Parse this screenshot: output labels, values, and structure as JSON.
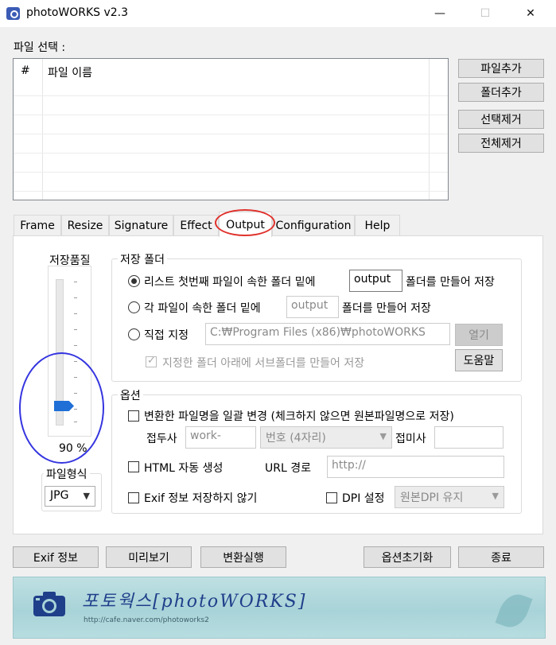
{
  "window": {
    "title": "photoWORKS v2.3",
    "minimize": "—",
    "maximize": "☐",
    "close": "✕"
  },
  "file_select": {
    "label": "파일 선택 :",
    "columns": [
      "#",
      "파일 이름"
    ],
    "buttons": {
      "add_file": "파일추가",
      "add_folder": "폴더추가",
      "remove_selected": "선택제거",
      "remove_all": "전체제거"
    }
  },
  "tabs": [
    "Frame",
    "Resize",
    "Signature",
    "Effect",
    "Output",
    "Configuration",
    "Help"
  ],
  "active_tab": "Output",
  "quality": {
    "label": "저장품질",
    "value": 90,
    "value_text": "90 %"
  },
  "file_format": {
    "label": "파일형식",
    "selected": "JPG"
  },
  "save_folder": {
    "label": "저장 폴더",
    "opt1_prefix": "리스트 첫번째 파일이 속한 폴더 밑에",
    "opt1_value": "output",
    "opt1_suffix": "폴더를 만들어 저장",
    "opt2_prefix": "각 파일이 속한 폴더 밑에",
    "opt2_value": "output",
    "opt2_suffix": "폴더를 만들어 저장",
    "opt3_label": "직접 지정",
    "opt3_path": "C:₩Program Files (x86)₩photoWORKS",
    "open_button": "열기",
    "subfolder_check": "지정한 폴더 아래에 서브폴더를 만들어 저장",
    "help_button": "도움말",
    "selected_option": 1
  },
  "options": {
    "label": "옵션",
    "rename_check": "변환한 파일명을 일괄 변경 (체크하지 않으면 원본파일명으로 저장)",
    "prefix_label": "접두사",
    "prefix_value": "work-",
    "number_select": "번호 (4자리)",
    "suffix_label": "접미사",
    "suffix_value": "",
    "html_check": "HTML 자동 생성",
    "url_label": "URL 경로",
    "url_value": "http://",
    "exif_check": "Exif 정보 저장하지 않기",
    "dpi_check": "DPI 설정",
    "dpi_select": "원본DPI 유지"
  },
  "bottom_buttons": {
    "exif_info": "Exif 정보",
    "preview": "미리보기",
    "convert": "변환실행",
    "reset_options": "옵션초기화",
    "exit": "종료"
  },
  "banner": {
    "title": "포토웍스[photoWORKS]",
    "url": "http://cafe.naver.com/photoworks2"
  }
}
